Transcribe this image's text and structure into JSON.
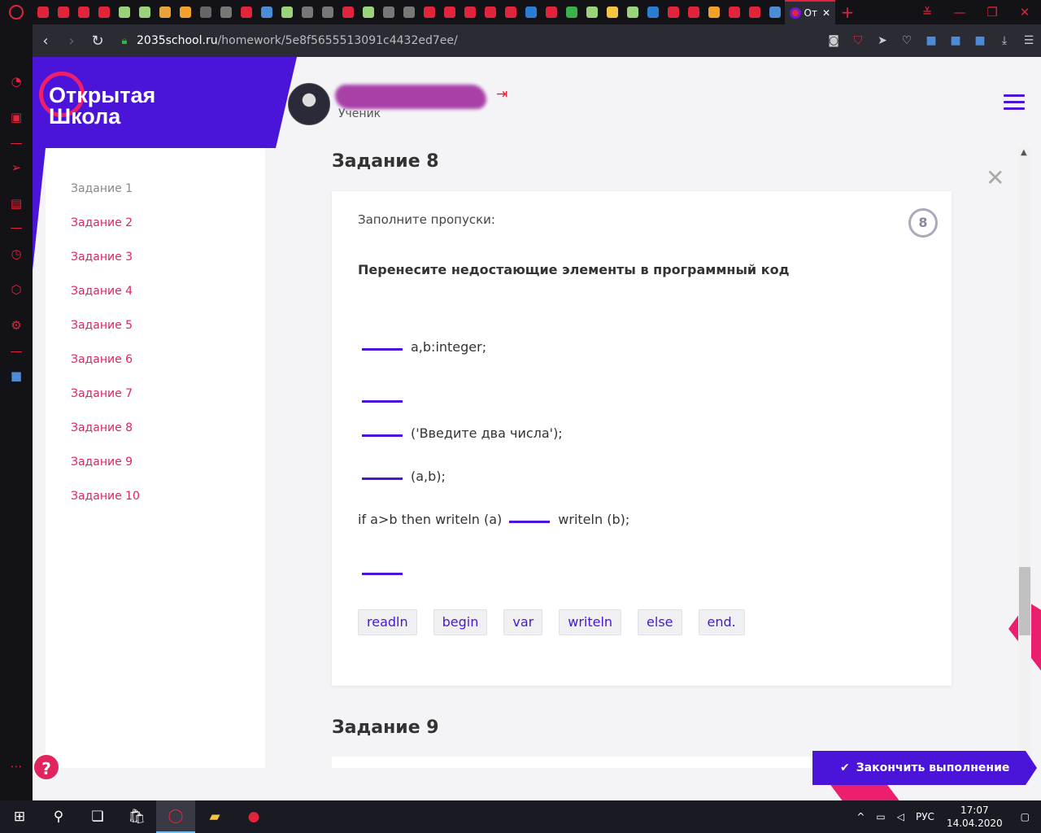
{
  "browser": {
    "active_tab_label": "От",
    "url_host": "2035school.ru",
    "url_path": "/homework/5e8f5655513091c4432ed7ee/",
    "new_tab_symbol": "+"
  },
  "header": {
    "logo_line1": "Открытая",
    "logo_line2": "Школа",
    "user_role": "Ученик"
  },
  "tasks_nav": {
    "items": [
      {
        "label": "Задание 1"
      },
      {
        "label": "Задание 2"
      },
      {
        "label": "Задание 3"
      },
      {
        "label": "Задание 4"
      },
      {
        "label": "Задание 5"
      },
      {
        "label": "Задание 6"
      },
      {
        "label": "Задание 7"
      },
      {
        "label": "Задание 8"
      },
      {
        "label": "Задание 9"
      },
      {
        "label": "Задание 10"
      }
    ]
  },
  "task8": {
    "title": "Задание 8",
    "instruction": "Заполните пропуски:",
    "badge": "8",
    "question": "Перенесите недостающие элементы в программный код",
    "code_lines": [
      {
        "after": "a,b:integer;"
      },
      {
        "after": ""
      },
      {
        "after": "('Введите два числа');"
      },
      {
        "after": "(a,b);"
      },
      {
        "before": "if a>b then writeln (a)",
        "after": "writeln (b);"
      },
      {
        "after": ""
      }
    ],
    "word_bank": [
      "readln",
      "begin",
      "var",
      "writeln",
      "else",
      "end."
    ]
  },
  "task9": {
    "title": "Задание 9"
  },
  "actions": {
    "help_label": "?",
    "finish_label": "Закончить выполнение"
  },
  "taskbar": {
    "language": "РУС",
    "time": "17:07",
    "date": "14.04.2020"
  },
  "colors": {
    "brand_purple": "#4a14d9",
    "brand_pink": "#ec1e6e",
    "link_pink": "#e0245e"
  }
}
